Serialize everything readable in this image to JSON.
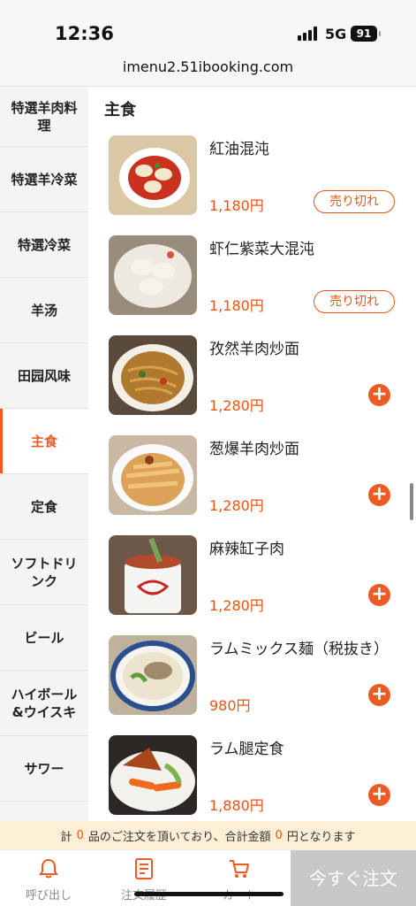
{
  "status_bar": {
    "time": "12:36",
    "network": "5G",
    "battery": "91"
  },
  "browser": {
    "url": "imenu2.51ibooking.com"
  },
  "sidebar": {
    "categories": [
      {
        "label": "特選羊肉料理"
      },
      {
        "label": "特選羊冷菜"
      },
      {
        "label": "特選冷菜"
      },
      {
        "label": "羊汤"
      },
      {
        "label": "田园风味"
      },
      {
        "label": "主食"
      },
      {
        "label": "定食"
      },
      {
        "label": "ソフトドリンク"
      },
      {
        "label": "ビール"
      },
      {
        "label": "ハイボール&ウイスキ"
      },
      {
        "label": "サワー"
      }
    ],
    "active_index": 5
  },
  "main": {
    "section_title": "主食",
    "items": [
      {
        "name": "紅油混沌",
        "price": "1,180円",
        "sold_out_label": "売り切れ"
      },
      {
        "name": "虾仁紫菜大混沌",
        "price": "1,180円",
        "sold_out_label": "売り切れ"
      },
      {
        "name": "孜然羊肉炒面",
        "price": "1,280円",
        "add_icon": "plus-icon"
      },
      {
        "name": "葱爆羊肉炒面",
        "price": "1,280円",
        "add_icon": "plus-icon"
      },
      {
        "name": "麻辣缸子肉",
        "price": "1,280円",
        "add_icon": "plus-icon"
      },
      {
        "name": "ラムミックス麺（税抜き）",
        "price": "980円",
        "add_icon": "plus-icon"
      },
      {
        "name": "ラム腿定食",
        "price": "1,880円",
        "add_icon": "plus-icon"
      }
    ]
  },
  "notice": {
    "prefix": "計",
    "item_count": "0",
    "middle": "品のご注文を頂いており、合計金額",
    "total": "0",
    "suffix": "円となります"
  },
  "bottom_nav": {
    "call_label": "呼び出し",
    "history_label": "注文履歴",
    "cart_label": "カート",
    "order_button_label": "今すぐ注文"
  },
  "colors": {
    "accent": "#EA5514",
    "notice_bg": "#FCEFD6",
    "order_button_bg": "#C8C8C8"
  }
}
